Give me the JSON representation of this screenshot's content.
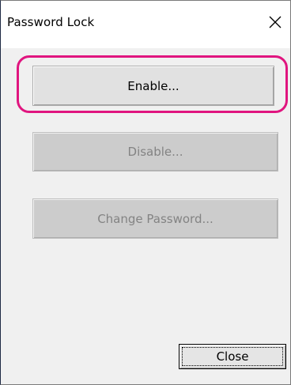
{
  "window": {
    "title": "Password Lock"
  },
  "buttons": {
    "enable_label": "Enable...",
    "disable_label": "Disable...",
    "change_password_label": "Change Password...",
    "close_label": "Close"
  },
  "states": {
    "enable_enabled": true,
    "disable_enabled": false,
    "change_password_enabled": false,
    "close_focused": true
  },
  "icons": {
    "title_close": "close-icon"
  },
  "colors": {
    "highlight": "#e0157f",
    "dialog_background": "#f0f0f0",
    "disabled_text": "#838383"
  }
}
